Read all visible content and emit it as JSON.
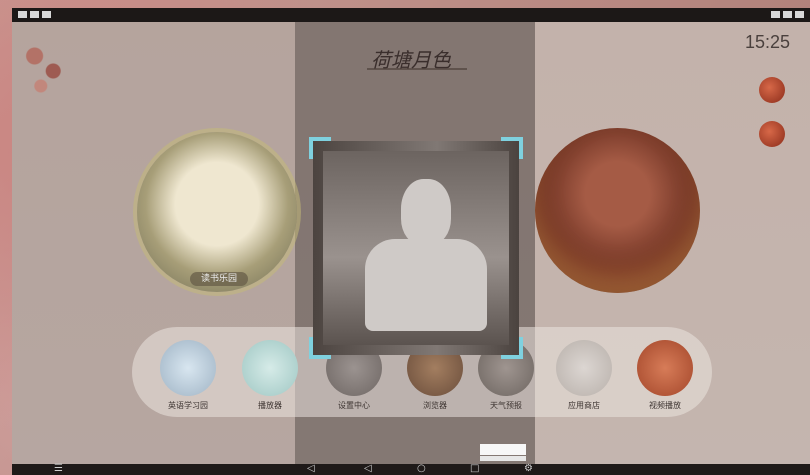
{
  "screen": {
    "time": "15:25",
    "app_title": "荷塘月色",
    "book_label": "读书乐园"
  },
  "dock": {
    "items": [
      {
        "label": "英语学习园"
      },
      {
        "label": "播放器"
      },
      {
        "label": "设置中心"
      },
      {
        "label": "浏览器"
      },
      {
        "label": "天气预报"
      },
      {
        "label": "应用商店"
      },
      {
        "label": "视频播放"
      }
    ]
  },
  "nav": {
    "menu": "☰",
    "volume": "◁",
    "back": "◁",
    "home": "○",
    "recents": "□",
    "settings": "⚙"
  }
}
